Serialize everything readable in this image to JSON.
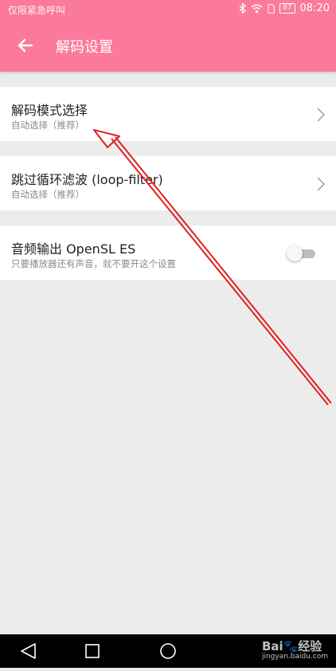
{
  "status_bar": {
    "carrier_text": "仅限紧急呼叫",
    "battery_level": "87",
    "time": "08:20"
  },
  "app_bar": {
    "title": "解码设置"
  },
  "settings": [
    {
      "title": "解码模式选择",
      "subtitle": "自动选择（推荐）"
    },
    {
      "title": "跳过循环滤波 (loop-filter)",
      "subtitle": "自动选择（推荐）"
    },
    {
      "title": "音频输出 OpenSL ES",
      "subtitle": "只要播放器还有声音，就不要开这个设置",
      "toggle_on": false
    }
  ],
  "watermark": {
    "brand": "Bai🐾经验",
    "url": "jingyan.baidu.com"
  },
  "colors": {
    "accent": "#fb7a9c",
    "annotation_arrow": "#e02020"
  }
}
